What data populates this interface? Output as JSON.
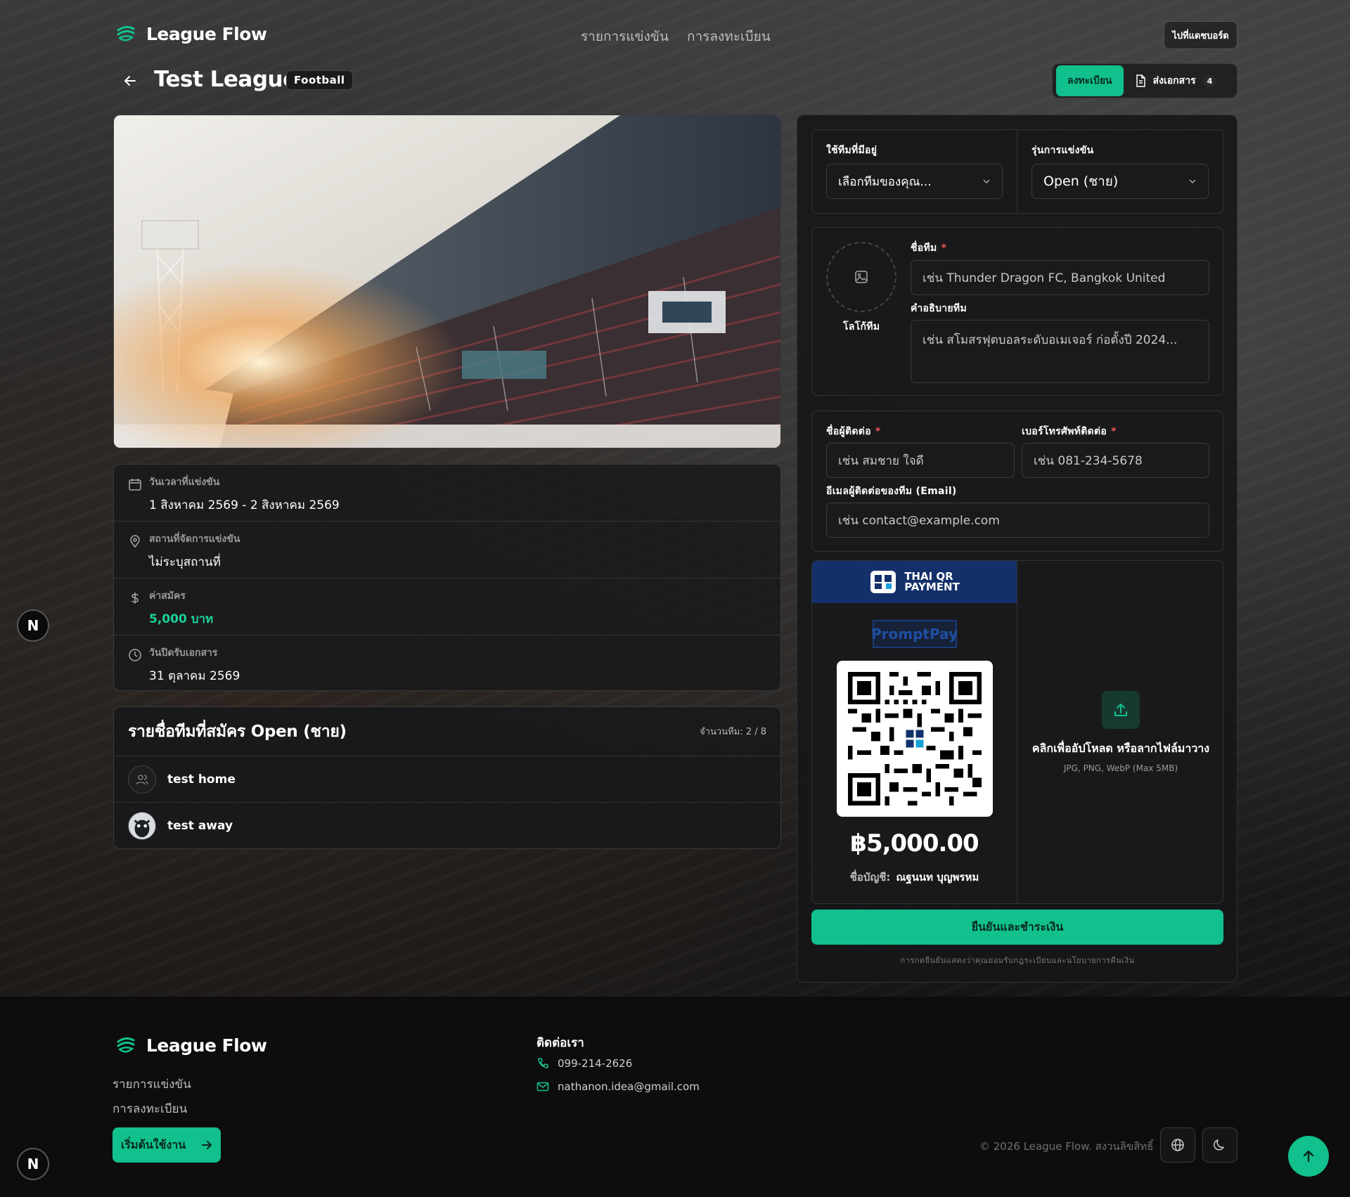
{
  "brand": {
    "name": "League Flow",
    "accent": "#11c08d"
  },
  "nav": {
    "links": [
      "รายการแข่งขัน",
      "การลงทะเบียน"
    ],
    "dashboard_button": "ไปที่แดชบอร์ด"
  },
  "page": {
    "title": "Test League",
    "sport_badge": "Football",
    "tabs": {
      "register": "ลงทะเบียน",
      "documents": "ส่งเอกสาร",
      "documents_count": "4"
    }
  },
  "event_info": {
    "date": {
      "label": "วันเวลาที่แข่งขัน",
      "value": "1 สิงหาคม 2569 - 2 สิงหาคม 2569"
    },
    "venue": {
      "label": "สถานที่จัดการแข่งขัน",
      "value": "ไม่ระบุสถานที่"
    },
    "fee": {
      "label": "ค่าสมัคร",
      "value": "5,000 บาท"
    },
    "deadline": {
      "label": "วันปิดรับเอกสาร",
      "value": "31 ตุลาคม 2569"
    }
  },
  "teams": {
    "title": "รายชื่อทีมที่สมัคร Open (ชาย)",
    "count": "จำนวนทีม: 2 / 8",
    "list": [
      "test home",
      "test away"
    ]
  },
  "form": {
    "existing_team_label": "ใช้ทีมที่มีอยู่",
    "existing_team_value": "เลือกทีมของคุณ...",
    "division_label": "รุ่นการแข่งขัน",
    "division_value": "Open (ชาย)",
    "logo_label": "โลโก้ทีม",
    "team_name_label": "ชื่อทีม",
    "team_name_placeholder": "เช่น Thunder Dragon FC, Bangkok United",
    "team_desc_label": "คำอธิบายทีม",
    "team_desc_placeholder": "เช่น สโมสรฟุตบอลระดับอเมเจอร์ ก่อตั้งปี 2024...",
    "contact_name_label": "ชื่อผู้ติดต่อ",
    "contact_name_placeholder": "เช่น สมชาย ใจดี",
    "phone_label": "เบอร์โทรศัพท์ติดต่อ",
    "phone_placeholder": "เช่น 081-234-5678",
    "email_label": "อีเมลผู้ติดต่อของทีม (Email)",
    "email_placeholder": "เช่น contact@example.com",
    "required_mark": "*"
  },
  "payment": {
    "banner_line1": "THAI QR",
    "banner_line2": "PAYMENT",
    "promptpay": "PromptPay",
    "amount": "฿5,000.00",
    "account_key": "ชื่อบัญชี:",
    "account_name": "ณฐนนท บุญพรหม",
    "upload_title": "คลิกเพื่ออัปโหลด หรือลากไฟล์มาวาง",
    "upload_hint": "JPG, PNG, WebP (Max 5MB)",
    "confirm_button": "ยืนยันและชำระเงิน",
    "terms": "การกดยืนยันแสดงว่าคุณยอมรับกฎระเบียบและนโยบายการคืนเงิน"
  },
  "footer": {
    "links": [
      "รายการแข่งขัน",
      "การลงทะเบียน"
    ],
    "cta": "เริ่มต้นใช้งาน",
    "contact_title": "ติดต่อเรา",
    "phone": "099-214-2626",
    "email": "nathanon.idea@gmail.com",
    "copyright": "© 2026 League Flow. สงวนลิขสิทธิ์"
  },
  "floating": {
    "n_badge": "N"
  }
}
